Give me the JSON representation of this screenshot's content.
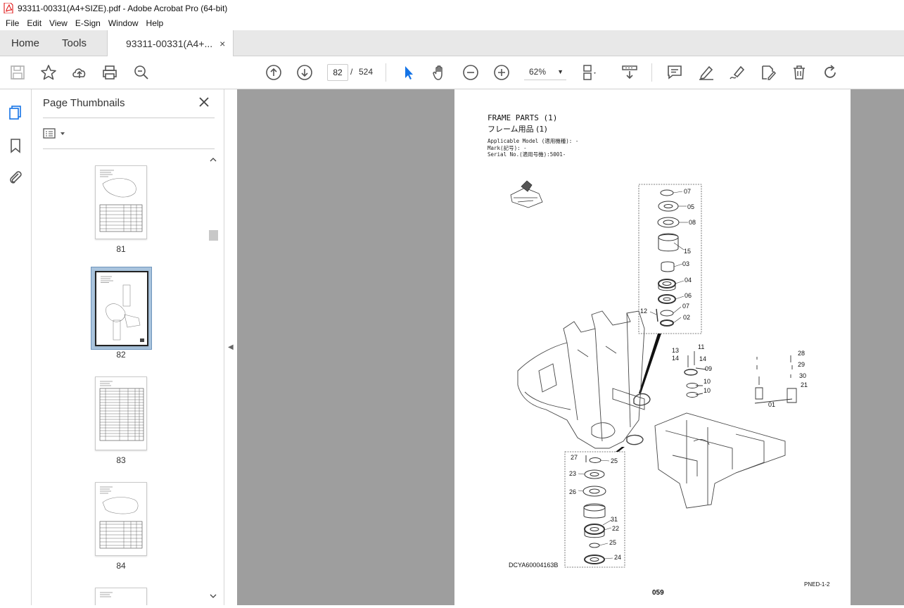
{
  "window": {
    "title": "93311-00331(A4+SIZE).pdf - Adobe Acrobat Pro (64-bit)"
  },
  "menu": {
    "items": [
      "File",
      "Edit",
      "View",
      "E-Sign",
      "Window",
      "Help"
    ]
  },
  "tabs": {
    "home": "Home",
    "tools": "Tools",
    "document": "93311-00331(A4+...",
    "close": "×"
  },
  "toolbar": {
    "current_page": "82",
    "page_sep": "/",
    "total_pages": "524",
    "zoom": "62%"
  },
  "thumbnails_panel": {
    "title": "Page Thumbnails",
    "pages": [
      {
        "label": "81"
      },
      {
        "label": "82",
        "selected": true
      },
      {
        "label": "83"
      },
      {
        "label": "84"
      }
    ]
  },
  "pdf_page": {
    "title_en": "FRAME PARTS (1)",
    "title_jp": "フレーム用品 (1)",
    "meta": [
      "Applicable Model (適用機種): -",
      "Mark(記号): -",
      "Serial No.(適用号機):5001-"
    ],
    "drawing_code": "DCYA60004163B",
    "page_number": "059",
    "ref": "PNED-1-2",
    "callouts": [
      "07",
      "05",
      "08",
      "15",
      "03",
      "04",
      "06",
      "07",
      "02",
      "12",
      "11",
      "13",
      "14",
      "14",
      "09",
      "10",
      "10",
      "28",
      "29",
      "30",
      "21",
      "01",
      "27",
      "25",
      "23",
      "26",
      "31",
      "22",
      "25",
      "24"
    ]
  },
  "colors": {
    "accent_blue": "#1473e6",
    "viewer_bg": "#9e9e9e",
    "selection": "#a9c4dd"
  }
}
